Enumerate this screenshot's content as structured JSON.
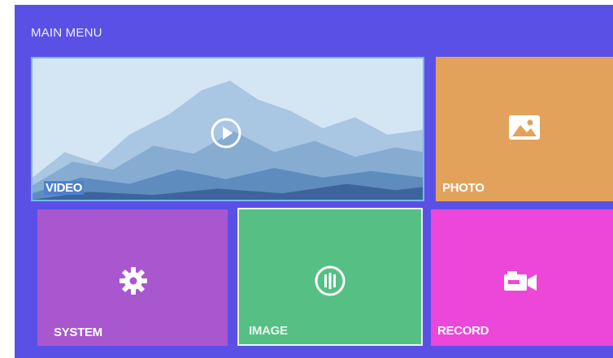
{
  "header": {
    "title": "MAIN MENU"
  },
  "tiles": [
    {
      "label": "VIDEO",
      "icon": "play-icon",
      "color": "#cfe3f3",
      "selected": true
    },
    {
      "label": "PHOTO",
      "icon": "image-icon",
      "color": "#e3a25c"
    },
    {
      "label": "SYSTEM",
      "icon": "gear-icon",
      "color": "#a957cf"
    },
    {
      "label": "IMAGE",
      "icon": "sliders-icon",
      "color": "#56bf84"
    },
    {
      "label": "RECORD",
      "icon": "camcorder-icon",
      "color": "#ec47d8"
    }
  ],
  "colors": {
    "background": "#5a50e6",
    "selection_border": "#77b8ef"
  }
}
